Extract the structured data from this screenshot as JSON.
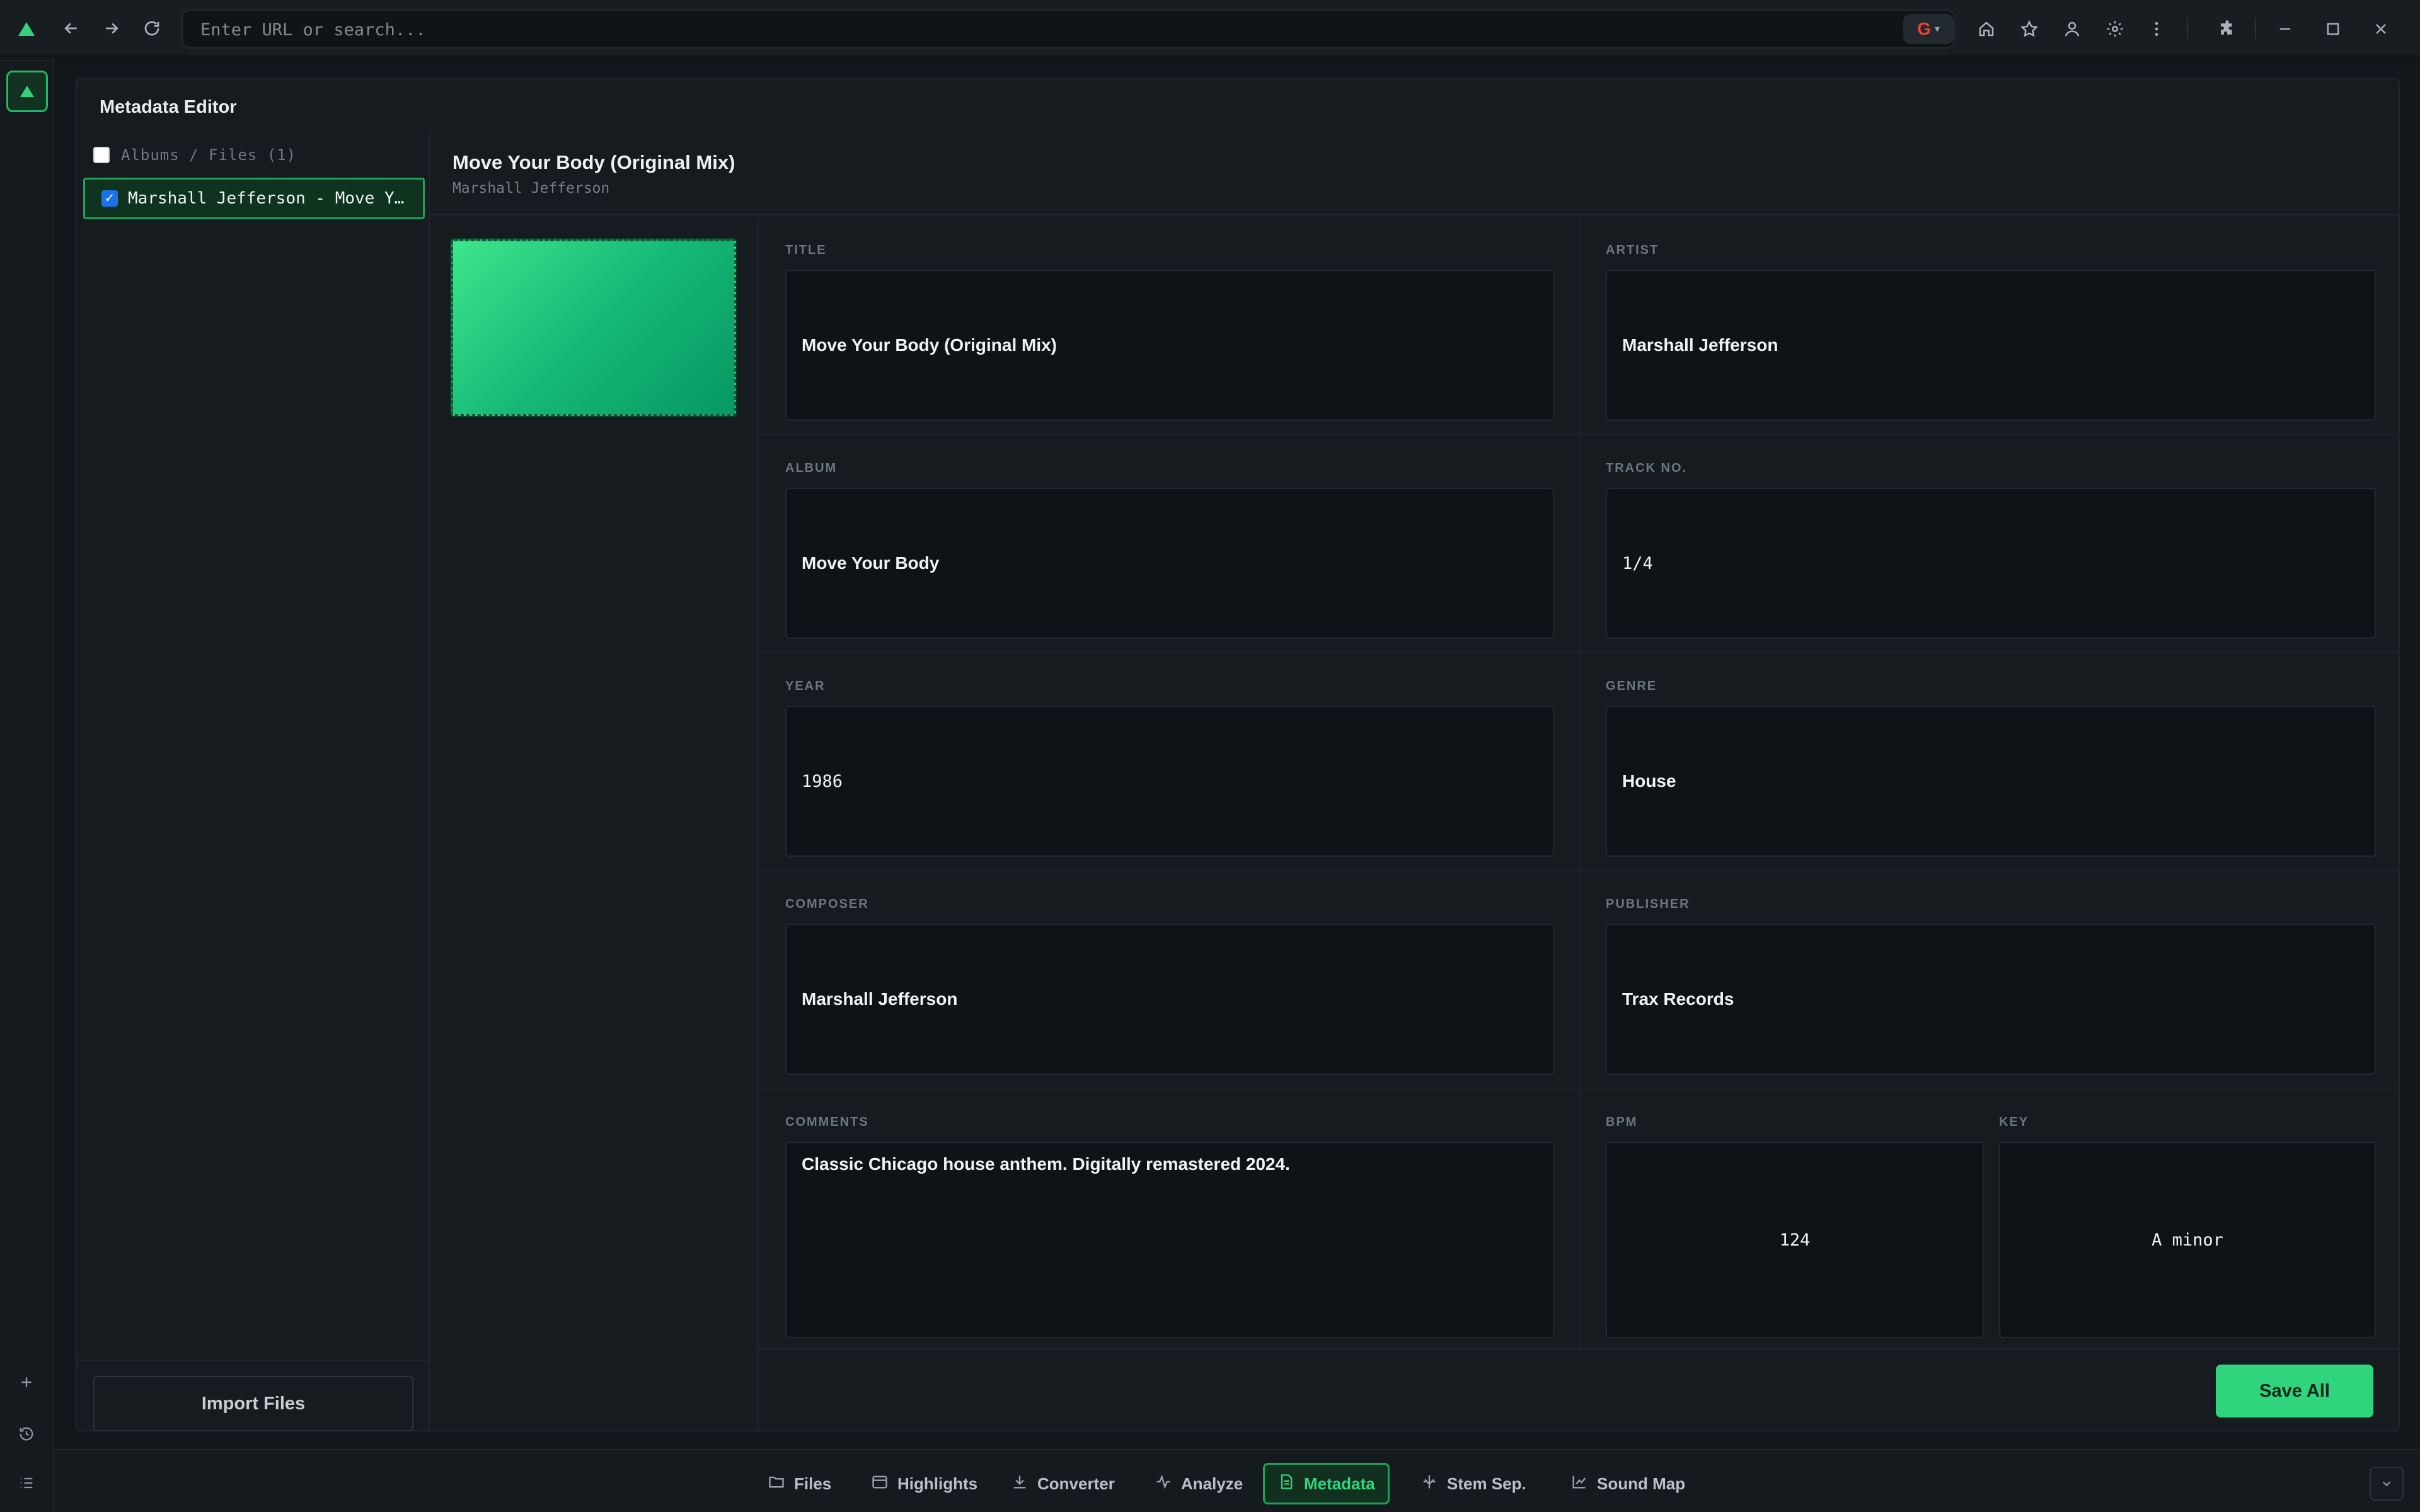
{
  "browser": {
    "url_placeholder": "Enter URL or search...",
    "search_engine": "G",
    "icons": [
      "back-arrow-icon",
      "forward-arrow-icon",
      "reload-icon",
      "home-icon",
      "star-icon",
      "profile-icon",
      "gear-icon",
      "kebab-menu-icon",
      "puzzle-icon",
      "minimize-icon",
      "maximize-icon",
      "close-icon"
    ]
  },
  "editor": {
    "title": "Metadata Editor",
    "file_list": {
      "header": "Albums / Files (1)",
      "items": [
        {
          "label": "Marshall Jefferson - Move Your Body (Original Mix)",
          "checked": true
        }
      ],
      "import_label": "Import Files"
    },
    "track": {
      "title": "Move Your Body (Original Mix)",
      "artist": "Marshall Jefferson"
    },
    "fields": {
      "title": {
        "label": "TITLE",
        "value": "Move Your Body (Original Mix)"
      },
      "artist": {
        "label": "ARTIST",
        "value": "Marshall Jefferson"
      },
      "album": {
        "label": "ALBUM",
        "value": "Move Your Body"
      },
      "track_no": {
        "label": "TRACK NO.",
        "value": "1/4"
      },
      "year": {
        "label": "YEAR",
        "value": "1986"
      },
      "genre": {
        "label": "GENRE",
        "value": "House"
      },
      "composer": {
        "label": "COMPOSER",
        "value": "Marshall Jefferson"
      },
      "publisher": {
        "label": "PUBLISHER",
        "value": "Trax Records"
      },
      "comments": {
        "label": "COMMENTS",
        "value": "Classic Chicago house anthem. Digitally remastered 2024."
      },
      "bpm": {
        "label": "BPM",
        "value": "124"
      },
      "key": {
        "label": "KEY",
        "value": "A minor"
      }
    },
    "save_label": "Save All"
  },
  "tabs": [
    {
      "label": "Files",
      "icon": "folder-icon"
    },
    {
      "label": "Highlights",
      "icon": "calendar-icon"
    },
    {
      "label": "Converter",
      "icon": "download-icon"
    },
    {
      "label": "Analyze",
      "icon": "activity-icon"
    },
    {
      "label": "Metadata",
      "icon": "document-icon",
      "active": true
    },
    {
      "label": "Stem Sep.",
      "icon": "split-icon"
    },
    {
      "label": "Sound Map",
      "icon": "chart-icon"
    }
  ],
  "colors": {
    "accent": "#2fd47c",
    "background": "#12171b",
    "panel": "#151b1f",
    "field": "#0f1317"
  }
}
